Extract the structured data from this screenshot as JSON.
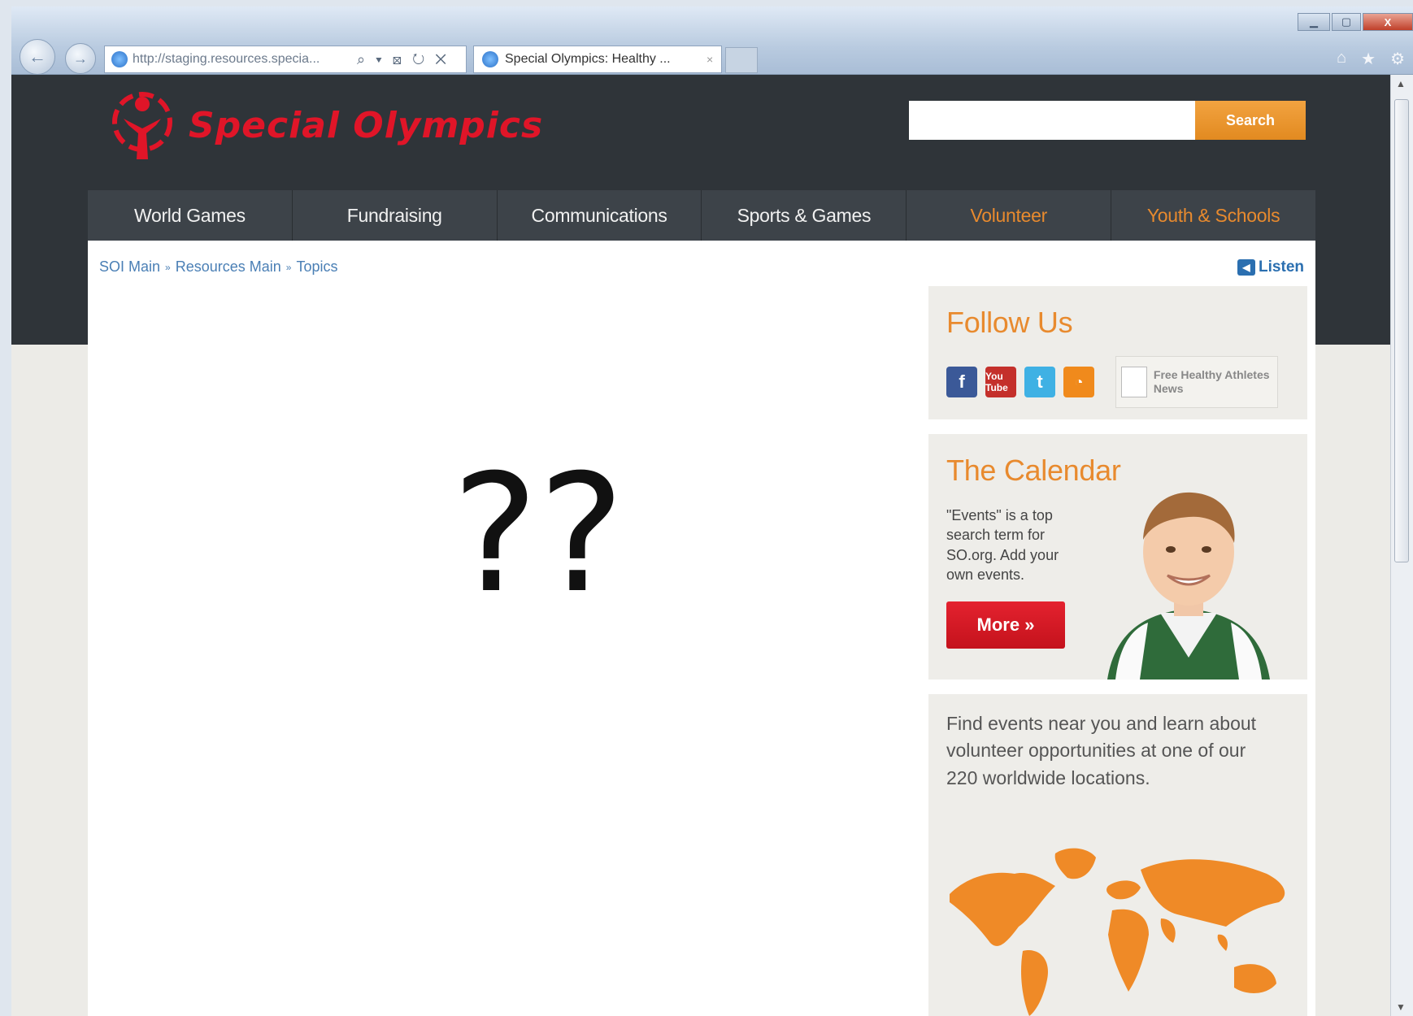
{
  "browser": {
    "address": "http://staging.resources.specia...",
    "address_tools": "⌕ ▾ ⊠ ↻ ✕",
    "tab_title": "Special Olympics: Healthy ...",
    "tab_close": "×",
    "back_glyph": "←",
    "forward_glyph": "→",
    "min_glyph": "▁",
    "max_glyph": "▢",
    "close_glyph": "X",
    "home_glyph": "⌂",
    "fav_glyph": "★",
    "tools_glyph": "⚙"
  },
  "site": {
    "logo_text": "Special Olympics",
    "brand_color": "#e01528",
    "accent_color": "#e88a2e"
  },
  "search": {
    "value": "",
    "placeholder": "",
    "button_label": "Search"
  },
  "nav": {
    "items": [
      {
        "label": "World Games"
      },
      {
        "label": "Fundraising"
      },
      {
        "label": "Communications"
      },
      {
        "label": "Sports & Games"
      },
      {
        "label": "Volunteer"
      },
      {
        "label": "Youth & Schools"
      }
    ]
  },
  "breadcrumb": {
    "items": [
      "SOI Main",
      "Resources Main",
      "Topics"
    ],
    "sep": "»"
  },
  "listen": {
    "label": "Listen",
    "icon_glyph": "◀"
  },
  "main": {
    "placeholder_text": "??"
  },
  "follow": {
    "title": "Follow Us",
    "icons": {
      "facebook": "f",
      "youtube": "You Tube",
      "twitter": "t",
      "rss": "◔"
    },
    "news_link": "Free Healthy Athletes News"
  },
  "calendar": {
    "title": "The Calendar",
    "text": "\"Events\" is a top search term for SO.org. Add your own events.",
    "more_label": "More »"
  },
  "events": {
    "text": "Find events near you and learn about volunteer opportunities at one of our 220 worldwide locations."
  },
  "scrollbar": {
    "up_glyph": "▲",
    "down_glyph": "▼"
  }
}
